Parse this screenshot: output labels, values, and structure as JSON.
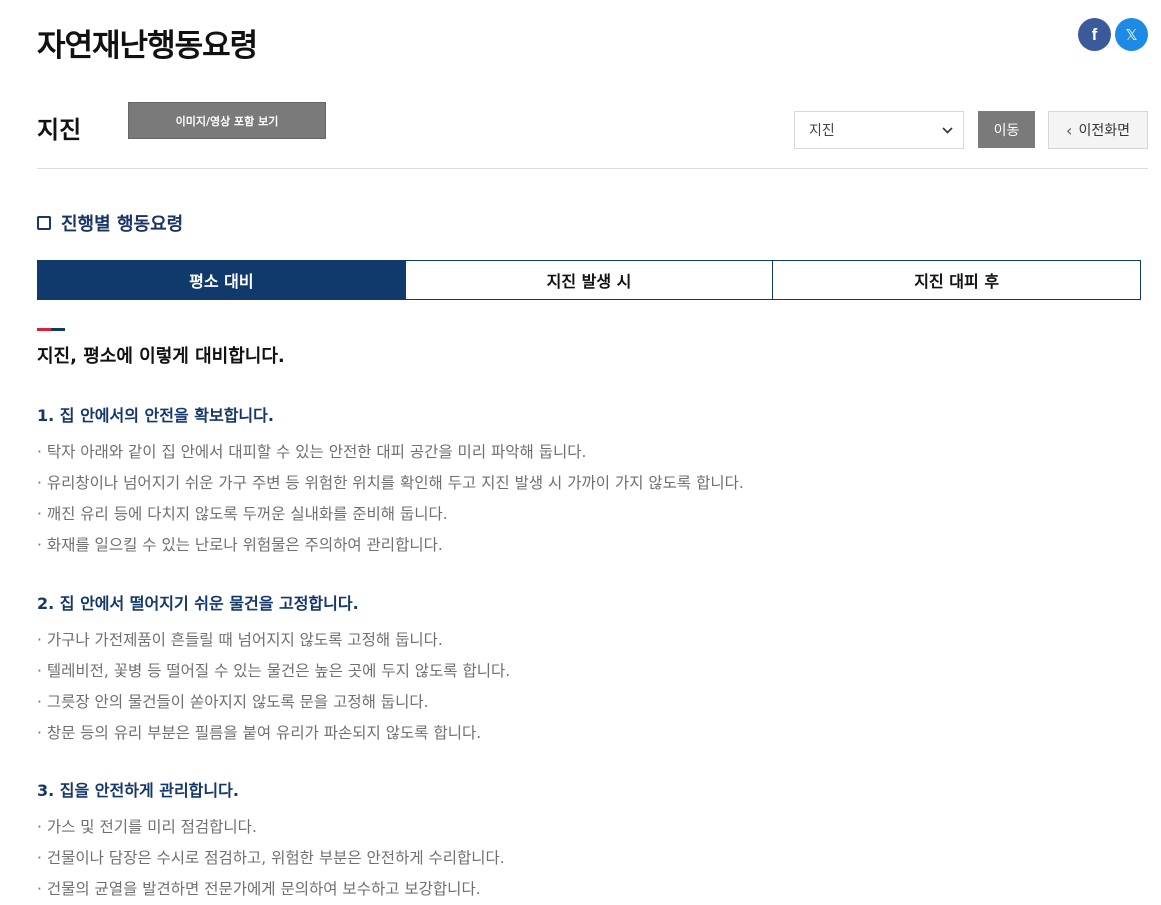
{
  "page": {
    "title": "자연재난행동요령"
  },
  "share": {
    "facebook_icon": "facebook-icon",
    "x_icon": "x-icon",
    "facebook_glyph": "f",
    "x_glyph": "𝕏"
  },
  "header": {
    "category": "지진",
    "media_button": "이미지/영상 포함 보기",
    "select_value": "지진",
    "go_button": "이동",
    "back_button": "이전화면",
    "back_glyph": "‹"
  },
  "section": {
    "title": "진행별 행동요령"
  },
  "tabs": [
    {
      "label": "평소 대비",
      "active": true
    },
    {
      "label": "지진 발생 시",
      "active": false
    },
    {
      "label": "지진 대피 후",
      "active": false
    }
  ],
  "content": {
    "heading": "지진, 평소에 이렇게 대비합니다.",
    "groups": [
      {
        "title": "1. 집 안에서의 안전을 확보합니다.",
        "items": [
          "· 탁자 아래와 같이 집 안에서 대피할 수 있는 안전한 대피 공간을 미리 파악해 둡니다.",
          "· 유리창이나 넘어지기 쉬운 가구 주변 등 위험한 위치를 확인해 두고 지진 발생 시 가까이 가지 않도록 합니다.",
          "· 깨진 유리 등에 다치지 않도록 두꺼운 실내화를 준비해 둡니다.",
          "· 화재를 일으킬 수 있는 난로나 위험물은 주의하여 관리합니다."
        ]
      },
      {
        "title": "2. 집 안에서 떨어지기 쉬운 물건을 고정합니다.",
        "items": [
          "· 가구나 가전제품이 흔들릴 때 넘어지지 않도록 고정해 둡니다.",
          "· 텔레비전, 꽃병 등 떨어질 수 있는 물건은 높은 곳에 두지 않도록 합니다.",
          "· 그릇장 안의 물건들이 쏟아지지 않도록 문을 고정해 둡니다.",
          "· 창문 등의 유리 부분은 필름을 붙여 유리가 파손되지 않도록 합니다."
        ]
      },
      {
        "title": "3. 집을 안전하게 관리합니다.",
        "items": [
          "· 가스 및 전기를 미리 점검합니다.",
          "· 건물이나 담장은 수시로 점검하고, 위험한 부분은 안전하게 수리합니다.",
          "· 건물의 균열을 발견하면 전문가에게 문의하여 보수하고 보강합니다."
        ]
      }
    ]
  },
  "colors": {
    "primary": "#0f3a6b",
    "accent_red": "#d6243a",
    "facebook": "#3b5a9a",
    "x": "#1d8ae6"
  }
}
